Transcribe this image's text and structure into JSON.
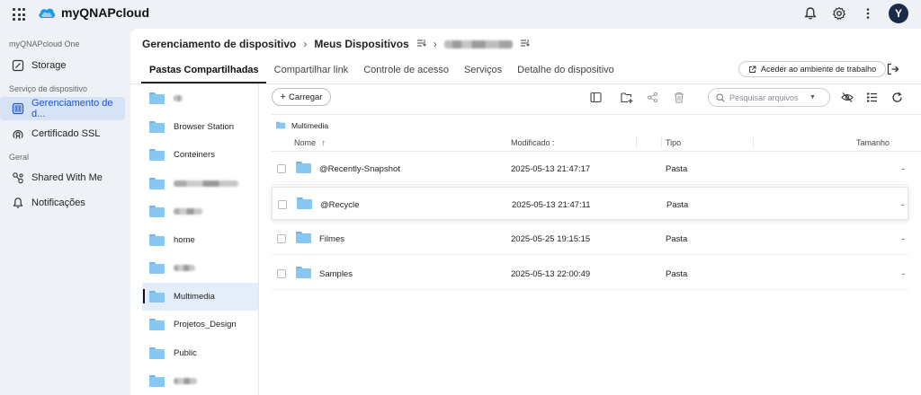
{
  "app": {
    "title": "myQNAPcloud",
    "avatar_letter": "Y"
  },
  "topbar": {
    "icons": [
      "apps-grid-icon",
      "bell-icon",
      "gear-icon",
      "more-vertical-icon"
    ]
  },
  "nav": {
    "section1": "myQNAPcloud One",
    "storage": "Storage",
    "section2": "Serviço de dispositivo",
    "device_mgmt": "Gerenciamento de d...",
    "ssl": "Certificado SSL",
    "section3": "Geral",
    "shared": "Shared With Me",
    "notifications": "Notificações"
  },
  "breadcrumb": {
    "root": "Gerenciamento de dispositivo",
    "devices": "Meus Dispositivos"
  },
  "tabs": [
    "Pastas Compartilhadas",
    "Compartilhar link",
    "Controle de acesso",
    "Serviços",
    "Detalhe do dispositivo"
  ],
  "access_button": "Aceder ao ambiente de trabalho",
  "tree": {
    "items": [
      {
        "label": "",
        "blurred": true,
        "blur_width": 10
      },
      {
        "label": "Browser Station"
      },
      {
        "label": "Conteiners"
      },
      {
        "label": "",
        "blurred": true,
        "blur_width": 72
      },
      {
        "label": "",
        "blurred": true,
        "blur_width": 32
      },
      {
        "label": "home"
      },
      {
        "label": "",
        "blurred": true,
        "blur_width": 24
      },
      {
        "label": "Multimedia",
        "active": true
      },
      {
        "label": "Projetos_Design"
      },
      {
        "label": "Public"
      },
      {
        "label": "",
        "blurred": true,
        "blur_width": 26
      }
    ]
  },
  "toolbar": {
    "upload_label": "Carregar",
    "search_placeholder": "Pesquisar arquivos"
  },
  "path": {
    "current": "Multimedia"
  },
  "columns": {
    "name": "Nome",
    "modified": "Modificado :",
    "type": "Tipo",
    "size": "Tamanho"
  },
  "files": [
    {
      "name": "@Recently-Snapshot",
      "modified": "2025-05-13 21:47:17",
      "type": "Pasta",
      "size": "-"
    },
    {
      "name": "@Recycle",
      "modified": "2025-05-13 21:47:11",
      "type": "Pasta",
      "size": "-"
    },
    {
      "name": "Filmes",
      "modified": "2025-05-25 19:15:15",
      "type": "Pasta",
      "size": "-"
    },
    {
      "name": "Samples",
      "modified": "2025-05-13 22:00:49",
      "type": "Pasta",
      "size": "-"
    }
  ],
  "colors": {
    "accent": "#1f56c4",
    "folder": "#87c7f2",
    "active_nav_bg": "#d6e2f6"
  }
}
